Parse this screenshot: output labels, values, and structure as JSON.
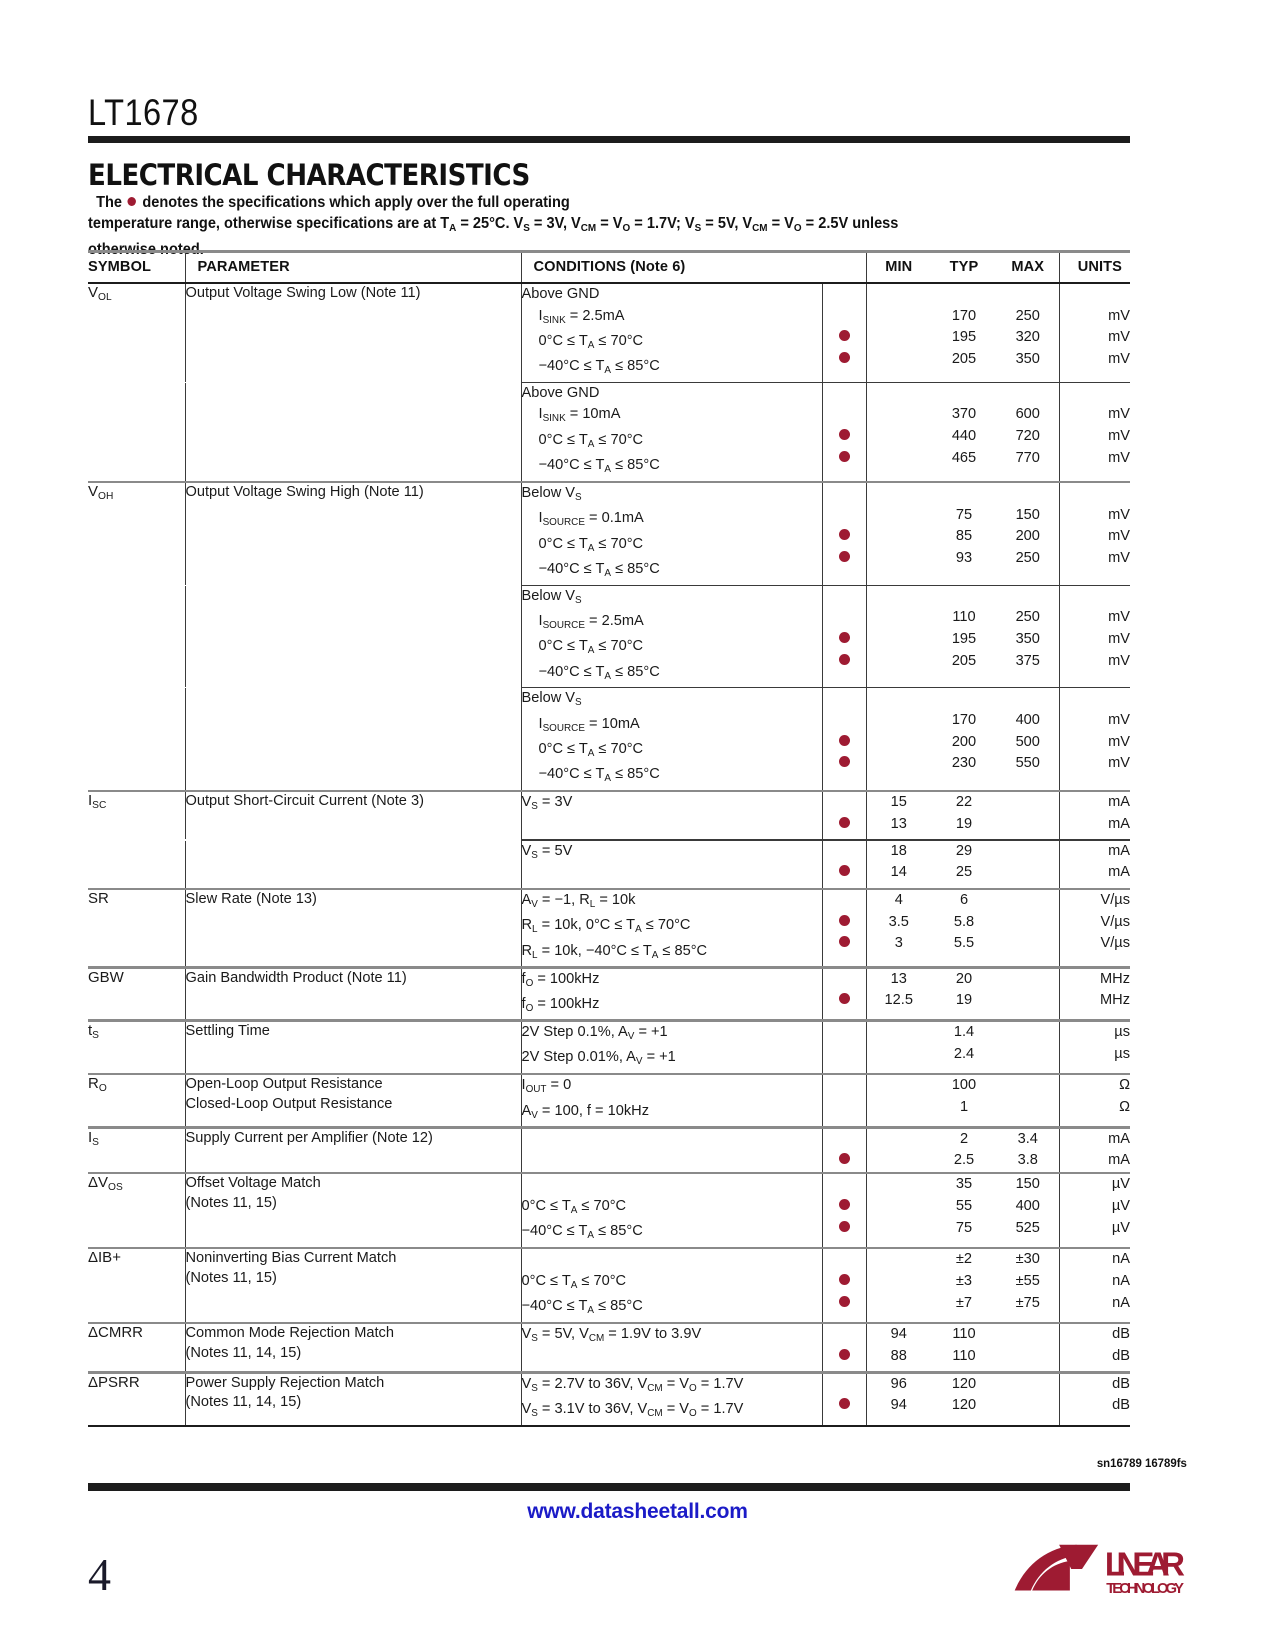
{
  "header": {
    "part_number": "LT1678"
  },
  "section": {
    "title": "ELECTRICAL CHARACTERISTICS",
    "note_lead": "The",
    "note_rest_1": "denotes the specifications which apply over the full operating",
    "note_line2_a": "temperature range, otherwise specifications are at T",
    "note_line2_a_sub": "A",
    "note_line2_b": " = 25°C. V",
    "note_line2_b_sub": "S",
    "note_line2_c": " = 3V, V",
    "note_line2_c_sub": "CM",
    "note_line2_d": " = V",
    "note_line2_d_sub": "O",
    "note_line2_e": " = 1.7V; V",
    "note_line2_e_sub": "S",
    "note_line2_f": " = 5V, V",
    "note_line2_f_sub": "CM",
    "note_line2_g": " = V",
    "note_line2_g_sub": "O",
    "note_line2_h": " = 2.5V unless",
    "note_line3": "otherwise noted."
  },
  "colors": {
    "bullet": "#9e1b32",
    "link": "#1b1bc7",
    "rule": "#1c1c1c",
    "separator": "#8a8a8a"
  },
  "table": {
    "columns": [
      "SYMBOL",
      "PARAMETER",
      "CONDITIONS (Note 6)",
      "MIN",
      "TYP",
      "MAX",
      "UNITS"
    ],
    "rows": [
      {
        "symbol": "V",
        "symbol_sub": "OL",
        "parameter": "Output Voltage Swing Low (Note 11)",
        "blocks": [
          {
            "cond_head": "Above GND",
            "lines": [
              {
                "cond": "I<sub>SINK</sub> = 2.5mA",
                "bullet": false,
                "min": "",
                "typ": "170",
                "max": "250",
                "units": "mV"
              },
              {
                "cond": "0°C ≤ T<sub>A</sub> ≤ 70°C",
                "bullet": true,
                "min": "",
                "typ": "195",
                "max": "320",
                "units": "mV"
              },
              {
                "cond": "−40°C ≤ T<sub>A</sub> ≤ 85°C",
                "bullet": true,
                "min": "",
                "typ": "205",
                "max": "350",
                "units": "mV"
              }
            ]
          },
          {
            "cond_head": "Above GND",
            "lines": [
              {
                "cond": "I<sub>SINK</sub> = 10mA",
                "bullet": false,
                "min": "",
                "typ": "370",
                "max": "600",
                "units": "mV"
              },
              {
                "cond": "0°C ≤ T<sub>A</sub> ≤ 70°C",
                "bullet": true,
                "min": "",
                "typ": "440",
                "max": "720",
                "units": "mV"
              },
              {
                "cond": "−40°C ≤ T<sub>A</sub> ≤ 85°C",
                "bullet": true,
                "min": "",
                "typ": "465",
                "max": "770",
                "units": "mV"
              }
            ]
          }
        ]
      },
      {
        "symbol": "V",
        "symbol_sub": "OH",
        "parameter": "Output Voltage Swing High (Note 11)",
        "blocks": [
          {
            "cond_head": "Below V<sub>S</sub>",
            "lines": [
              {
                "cond": "I<sub>SOURCE</sub> = 0.1mA",
                "bullet": false,
                "min": "",
                "typ": "75",
                "max": "150",
                "units": "mV"
              },
              {
                "cond": "0°C ≤ T<sub>A</sub> ≤ 70°C",
                "bullet": true,
                "min": "",
                "typ": "85",
                "max": "200",
                "units": "mV"
              },
              {
                "cond": "−40°C ≤ T<sub>A</sub> ≤ 85°C",
                "bullet": true,
                "min": "",
                "typ": "93",
                "max": "250",
                "units": "mV"
              }
            ]
          },
          {
            "cond_head": "Below V<sub>S</sub>",
            "lines": [
              {
                "cond": "I<sub>SOURCE</sub> = 2.5mA",
                "bullet": false,
                "min": "",
                "typ": "110",
                "max": "250",
                "units": "mV"
              },
              {
                "cond": "0°C ≤ T<sub>A</sub> ≤ 70°C",
                "bullet": true,
                "min": "",
                "typ": "195",
                "max": "350",
                "units": "mV"
              },
              {
                "cond": "−40°C ≤ T<sub>A</sub> ≤ 85°C",
                "bullet": true,
                "min": "",
                "typ": "205",
                "max": "375",
                "units": "mV"
              }
            ]
          },
          {
            "cond_head": "Below V<sub>S</sub>",
            "lines": [
              {
                "cond": "I<sub>SOURCE</sub> = 10mA",
                "bullet": false,
                "min": "",
                "typ": "170",
                "max": "400",
                "units": "mV"
              },
              {
                "cond": "0°C ≤ T<sub>A</sub> ≤ 70°C",
                "bullet": true,
                "min": "",
                "typ": "200",
                "max": "500",
                "units": "mV"
              },
              {
                "cond": "−40°C ≤ T<sub>A</sub> ≤ 85°C",
                "bullet": true,
                "min": "",
                "typ": "230",
                "max": "550",
                "units": "mV"
              }
            ]
          }
        ]
      },
      {
        "symbol": "I",
        "symbol_sub": "SC",
        "parameter": "Output Short-Circuit Current (Note 3)",
        "blocks": [
          {
            "cond_head": "",
            "lines": [
              {
                "cond": "V<sub>S</sub> = 3V",
                "bullet": false,
                "min": "15",
                "typ": "22",
                "max": "",
                "units": "mA"
              },
              {
                "cond": "",
                "bullet": true,
                "min": "13",
                "typ": "19",
                "max": "",
                "units": "mA"
              }
            ]
          },
          {
            "cond_head": "",
            "lines": [
              {
                "cond": "V<sub>S</sub> = 5V",
                "bullet": false,
                "min": "18",
                "typ": "29",
                "max": "",
                "units": "mA"
              },
              {
                "cond": "",
                "bullet": true,
                "min": "14",
                "typ": "25",
                "max": "",
                "units": "mA"
              }
            ]
          }
        ]
      },
      {
        "symbol": "SR",
        "symbol_sub": "",
        "parameter": "Slew Rate (Note 13)",
        "blocks": [
          {
            "cond_head": "",
            "lines": [
              {
                "cond": "A<sub>V</sub> = −1, R<sub>L</sub> = 10k",
                "bullet": false,
                "min": "4",
                "typ": "6",
                "max": "",
                "units": "V/µs"
              },
              {
                "cond": "R<sub>L</sub> = 10k, 0°C ≤ T<sub>A</sub> ≤ 70°C",
                "bullet": true,
                "min": "3.5",
                "typ": "5.8",
                "max": "",
                "units": "V/µs"
              },
              {
                "cond": "R<sub>L</sub> = 10k, −40°C ≤ T<sub>A</sub> ≤ 85°C",
                "bullet": true,
                "min": "3",
                "typ": "5.5",
                "max": "",
                "units": "V/µs"
              }
            ]
          }
        ]
      },
      {
        "symbol": "GBW",
        "symbol_sub": "",
        "parameter": "Gain Bandwidth Product (Note 11)",
        "blocks": [
          {
            "cond_head": "",
            "lines": [
              {
                "cond": "f<sub>O</sub> = 100kHz",
                "bullet": false,
                "min": "13",
                "typ": "20",
                "max": "",
                "units": "MHz"
              },
              {
                "cond": "f<sub>O</sub> = 100kHz",
                "bullet": true,
                "min": "12.5",
                "typ": "19",
                "max": "",
                "units": "MHz"
              }
            ]
          }
        ]
      },
      {
        "symbol": "t",
        "symbol_sub": "S",
        "parameter": "Settling Time",
        "blocks": [
          {
            "cond_head": "",
            "lines": [
              {
                "cond": "2V Step 0.1%, A<sub>V</sub> = +1",
                "bullet": false,
                "min": "",
                "typ": "1.4",
                "max": "",
                "units": "µs"
              },
              {
                "cond": "2V Step 0.01%, A<sub>V</sub> = +1",
                "bullet": false,
                "min": "",
                "typ": "2.4",
                "max": "",
                "units": "µs"
              }
            ]
          }
        ]
      },
      {
        "symbol": "R",
        "symbol_sub": "O",
        "parameter": "Open-Loop Output Resistance\nClosed-Loop Output Resistance",
        "parameter_lines": [
          "Open-Loop Output Resistance",
          "Closed-Loop Output Resistance"
        ],
        "blocks": [
          {
            "cond_head": "",
            "lines": [
              {
                "cond": "I<sub>OUT</sub> = 0",
                "bullet": false,
                "min": "",
                "typ": "100",
                "max": "",
                "units": "Ω"
              },
              {
                "cond": "A<sub>V</sub> = 100, f = 10kHz",
                "bullet": false,
                "min": "",
                "typ": "1",
                "max": "",
                "units": "Ω"
              }
            ]
          }
        ]
      },
      {
        "symbol": "I",
        "symbol_sub": "S",
        "parameter": "Supply Current per Amplifier (Note 12)",
        "blocks": [
          {
            "cond_head": "",
            "lines": [
              {
                "cond": "",
                "bullet": false,
                "min": "",
                "typ": "2",
                "max": "3.4",
                "units": "mA"
              },
              {
                "cond": "",
                "bullet": true,
                "min": "",
                "typ": "2.5",
                "max": "3.8",
                "units": "mA"
              }
            ]
          }
        ]
      },
      {
        "symbol": "ΔV",
        "symbol_sub": "OS",
        "parameter_lines": [
          "Offset Voltage Match",
          "(Notes 11, 15)"
        ],
        "blocks": [
          {
            "cond_head": "",
            "lines": [
              {
                "cond": "",
                "bullet": false,
                "min": "",
                "typ": "35",
                "max": "150",
                "units": "µV"
              },
              {
                "cond": "0°C ≤ T<sub>A</sub> ≤ 70°C",
                "bullet": true,
                "min": "",
                "typ": "55",
                "max": "400",
                "units": "µV"
              },
              {
                "cond": "−40°C ≤ T<sub>A</sub> ≤ 85°C",
                "bullet": true,
                "min": "",
                "typ": "75",
                "max": "525",
                "units": "µV"
              }
            ]
          }
        ]
      },
      {
        "symbol": "ΔIB+",
        "symbol_sub": "",
        "parameter_lines": [
          "Noninverting Bias Current Match",
          "(Notes 11, 15)"
        ],
        "blocks": [
          {
            "cond_head": "",
            "lines": [
              {
                "cond": "",
                "bullet": false,
                "min": "",
                "typ": "±2",
                "max": "±30",
                "units": "nA"
              },
              {
                "cond": "0°C ≤ T<sub>A</sub> ≤ 70°C",
                "bullet": true,
                "min": "",
                "typ": "±3",
                "max": "±55",
                "units": "nA"
              },
              {
                "cond": "−40°C ≤ T<sub>A</sub> ≤ 85°C",
                "bullet": true,
                "min": "",
                "typ": "±7",
                "max": "±75",
                "units": "nA"
              }
            ]
          }
        ]
      },
      {
        "symbol": "ΔCMRR",
        "symbol_sub": "",
        "parameter_lines": [
          "Common Mode Rejection Match",
          "(Notes 11, 14, 15)"
        ],
        "blocks": [
          {
            "cond_head": "",
            "lines": [
              {
                "cond": "V<sub>S</sub> = 5V, V<sub>CM</sub> = 1.9V to 3.9V",
                "bullet": false,
                "min": "94",
                "typ": "110",
                "max": "",
                "units": "dB"
              },
              {
                "cond": "",
                "bullet": true,
                "min": "88",
                "typ": "110",
                "max": "",
                "units": "dB"
              }
            ]
          }
        ]
      },
      {
        "symbol": "ΔPSRR",
        "symbol_sub": "",
        "parameter_lines": [
          "Power Supply Rejection Match",
          "(Notes 11, 14, 15)"
        ],
        "blocks": [
          {
            "cond_head": "",
            "lines": [
              {
                "cond": "V<sub>S</sub> = 2.7V to 36V, V<sub>CM</sub> = V<sub>O</sub> = 1.7V",
                "bullet": false,
                "min": "96",
                "typ": "120",
                "max": "",
                "units": "dB"
              },
              {
                "cond": "V<sub>S</sub> = 3.1V to 36V, V<sub>CM</sub> = V<sub>O</sub> = 1.7V",
                "bullet": true,
                "min": "94",
                "typ": "120",
                "max": "",
                "units": "dB"
              }
            ]
          }
        ]
      }
    ]
  },
  "footer": {
    "doc_code": "sn16789 16789fs",
    "page_number": "4",
    "website": "www.datasheetall.com",
    "logo_line1": "LINEAR",
    "logo_line2": "TECHNOLOGY"
  }
}
